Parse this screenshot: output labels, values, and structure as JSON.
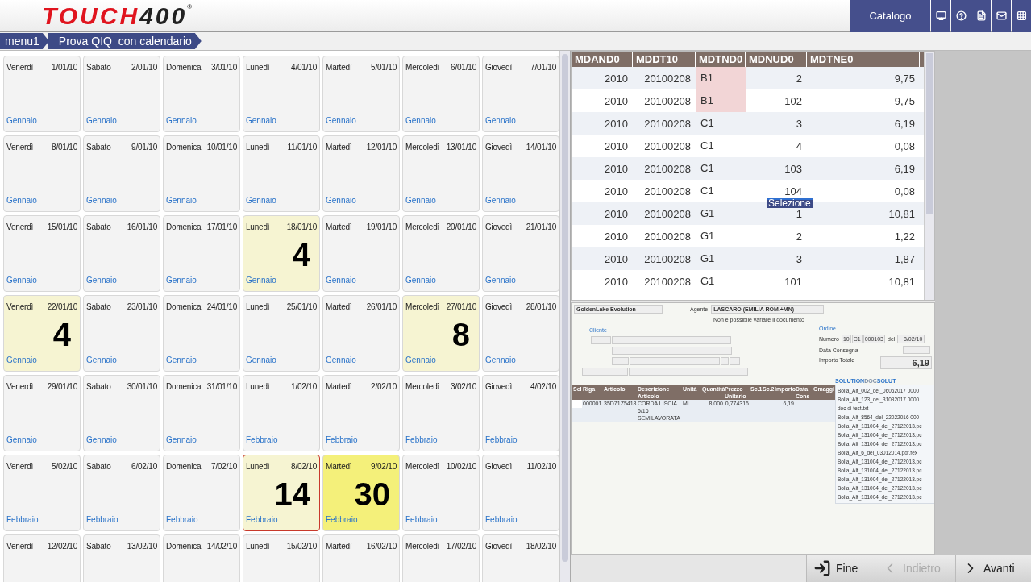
{
  "header": {
    "logo": {
      "red": "TOUCH",
      "dark": "400",
      "mark": "®"
    },
    "catalog_button": "Catalogo"
  },
  "breadcrumb": [
    "menu1",
    "Prova QIQ  con calendario"
  ],
  "calendar": [
    [
      {
        "day": "Venerdì",
        "date": "1/01/10",
        "month": "Gennaio",
        "color": "#f3f3f3",
        "selected": false
      },
      {
        "day": "Sabato",
        "date": "2/01/10",
        "month": "Gennaio",
        "color": "#f3f3f3",
        "selected": false
      },
      {
        "day": "Domenica",
        "date": "3/01/10",
        "month": "Gennaio",
        "color": "#f3f3f3",
        "selected": false
      },
      {
        "day": "Lunedì",
        "date": "4/01/10",
        "month": "Gennaio",
        "color": "#f3f3f3",
        "selected": false
      },
      {
        "day": "Martedì",
        "date": "5/01/10",
        "month": "Gennaio",
        "color": "#f3f3f3",
        "selected": false
      },
      {
        "day": "Mercoledì",
        "date": "6/01/10",
        "month": "Gennaio",
        "color": "#f3f3f3",
        "selected": false
      },
      {
        "day": "Giovedì",
        "date": "7/01/10",
        "month": "Gennaio",
        "color": "#f3f3f3",
        "selected": false
      }
    ],
    [
      {
        "day": "Venerdì",
        "date": "8/01/10",
        "month": "Gennaio",
        "color": "#f3f3f3",
        "selected": false
      },
      {
        "day": "Sabato",
        "date": "9/01/10",
        "month": "Gennaio",
        "color": "#f3f3f3",
        "selected": false
      },
      {
        "day": "Domenica",
        "date": "10/01/10",
        "month": "Gennaio",
        "color": "#f3f3f3",
        "selected": false
      },
      {
        "day": "Lunedì",
        "date": "11/01/10",
        "month": "Gennaio",
        "color": "#f3f3f3",
        "selected": false
      },
      {
        "day": "Martedì",
        "date": "12/01/10",
        "month": "Gennaio",
        "color": "#f3f3f3",
        "selected": false
      },
      {
        "day": "Mercoledì",
        "date": "13/01/10",
        "month": "Gennaio",
        "color": "#f3f3f3",
        "selected": false
      },
      {
        "day": "Giovedì",
        "date": "14/01/10",
        "month": "Gennaio",
        "color": "#f3f3f3",
        "selected": false
      }
    ],
    [
      {
        "day": "Venerdì",
        "date": "15/01/10",
        "month": "Gennaio",
        "color": "#f3f3f3",
        "selected": false
      },
      {
        "day": "Sabato",
        "date": "16/01/10",
        "month": "Gennaio",
        "color": "#f3f3f3",
        "selected": false
      },
      {
        "day": "Domenica",
        "date": "17/01/10",
        "month": "Gennaio",
        "color": "#f3f3f3",
        "selected": false
      },
      {
        "day": "Lunedì",
        "date": "18/01/10",
        "month": "Gennaio",
        "count": "4",
        "color": "#f6f4d2",
        "selected": false
      },
      {
        "day": "Martedì",
        "date": "19/01/10",
        "month": "Gennaio",
        "color": "#f3f3f3",
        "selected": false
      },
      {
        "day": "Mercoledì",
        "date": "20/01/10",
        "month": "Gennaio",
        "color": "#f3f3f3",
        "selected": false
      },
      {
        "day": "Giovedì",
        "date": "21/01/10",
        "month": "Gennaio",
        "color": "#f3f3f3",
        "selected": false
      }
    ],
    [
      {
        "day": "Venerdì",
        "date": "22/01/10",
        "month": "Gennaio",
        "count": "4",
        "color": "#f6f4d2",
        "selected": false
      },
      {
        "day": "Sabato",
        "date": "23/01/10",
        "month": "Gennaio",
        "color": "#f3f3f3",
        "selected": false
      },
      {
        "day": "Domenica",
        "date": "24/01/10",
        "month": "Gennaio",
        "color": "#f3f3f3",
        "selected": false
      },
      {
        "day": "Lunedì",
        "date": "25/01/10",
        "month": "Gennaio",
        "color": "#f3f3f3",
        "selected": false
      },
      {
        "day": "Martedì",
        "date": "26/01/10",
        "month": "Gennaio",
        "color": "#f3f3f3",
        "selected": false
      },
      {
        "day": "Mercoledì",
        "date": "27/01/10",
        "month": "Gennaio",
        "count": "8",
        "color": "#f6f4d2",
        "selected": false
      },
      {
        "day": "Giovedì",
        "date": "28/01/10",
        "month": "Gennaio",
        "color": "#f3f3f3",
        "selected": false
      }
    ],
    [
      {
        "day": "Venerdì",
        "date": "29/01/10",
        "month": "Gennaio",
        "color": "#f3f3f3",
        "selected": false
      },
      {
        "day": "Sabato",
        "date": "30/01/10",
        "month": "Gennaio",
        "color": "#f3f3f3",
        "selected": false
      },
      {
        "day": "Domenica",
        "date": "31/01/10",
        "month": "Gennaio",
        "color": "#f3f3f3",
        "selected": false
      },
      {
        "day": "Lunedì",
        "date": "1/02/10",
        "month": "Febbraio",
        "color": "#f3f3f3",
        "selected": false
      },
      {
        "day": "Martedì",
        "date": "2/02/10",
        "month": "Febbraio",
        "color": "#f3f3f3",
        "selected": false
      },
      {
        "day": "Mercoledì",
        "date": "3/02/10",
        "month": "Febbraio",
        "color": "#f3f3f3",
        "selected": false
      },
      {
        "day": "Giovedì",
        "date": "4/02/10",
        "month": "Febbraio",
        "color": "#f3f3f3",
        "selected": false
      }
    ],
    [
      {
        "day": "Venerdì",
        "date": "5/02/10",
        "month": "Febbraio",
        "color": "#f3f3f3",
        "selected": false
      },
      {
        "day": "Sabato",
        "date": "6/02/10",
        "month": "Febbraio",
        "color": "#f3f3f3",
        "selected": false
      },
      {
        "day": "Domenica",
        "date": "7/02/10",
        "month": "Febbraio",
        "color": "#f3f3f3",
        "selected": false
      },
      {
        "day": "Lunedì",
        "date": "8/02/10",
        "month": "Febbraio",
        "count": "14",
        "color": "#f6f4d2",
        "selected": true
      },
      {
        "day": "Martedì",
        "date": "9/02/10",
        "month": "Febbraio",
        "count": "30",
        "color": "#f4f07a",
        "selected": false
      },
      {
        "day": "Mercoledì",
        "date": "10/02/10",
        "month": "Febbraio",
        "color": "#f3f3f3",
        "selected": false
      },
      {
        "day": "Giovedì",
        "date": "11/02/10",
        "month": "Febbraio",
        "color": "#f3f3f3",
        "selected": false
      }
    ],
    [
      {
        "day": "Venerdì",
        "date": "12/02/10",
        "color": "#f3f3f3",
        "selected": false
      },
      {
        "day": "Sabato",
        "date": "13/02/10",
        "color": "#f3f3f3",
        "selected": false
      },
      {
        "day": "Domenica",
        "date": "14/02/10",
        "color": "#f3f3f3",
        "selected": false
      },
      {
        "day": "Lunedì",
        "date": "15/02/10",
        "color": "#f3f3f3",
        "selected": false
      },
      {
        "day": "Martedì",
        "date": "16/02/10",
        "color": "#f3f3f3",
        "selected": false
      },
      {
        "day": "Mercoledì",
        "date": "17/02/10",
        "color": "#f3f3f3",
        "selected": false
      },
      {
        "day": "Giovedì",
        "date": "18/02/10",
        "color": "#f3f3f3",
        "selected": false
      }
    ]
  ],
  "table": {
    "columns": [
      "MDAND0",
      "MDDT10",
      "MDTND0",
      "MDNUD0",
      "MDTNE0"
    ],
    "rows": [
      {
        "cells": [
          "2010",
          "20100208",
          "B1",
          "2",
          "9,75"
        ],
        "marked": true
      },
      {
        "cells": [
          "2010",
          "20100208",
          "B1",
          "102",
          "9,75"
        ],
        "marked": true
      },
      {
        "cells": [
          "2010",
          "20100208",
          "C1",
          "3",
          "6,19"
        ],
        "marked": false
      },
      {
        "cells": [
          "2010",
          "20100208",
          "C1",
          "4",
          "0,08"
        ],
        "marked": false
      },
      {
        "cells": [
          "2010",
          "20100208",
          "C1",
          "103",
          "6,19"
        ],
        "marked": false
      },
      {
        "cells": [
          "2010",
          "20100208",
          "C1",
          "104",
          "0,08"
        ],
        "marked": false
      },
      {
        "cells": [
          "2010",
          "20100208",
          "G1",
          "1",
          "10,81"
        ],
        "marked": false
      },
      {
        "cells": [
          "2010",
          "20100208",
          "G1",
          "2",
          "1,22"
        ],
        "marked": false
      },
      {
        "cells": [
          "2010",
          "20100208",
          "G1",
          "3",
          "1,87"
        ],
        "marked": false
      },
      {
        "cells": [
          "2010",
          "20100208",
          "G1",
          "101",
          "10,81"
        ],
        "marked": false
      }
    ],
    "tooltip": "Selezione"
  },
  "document": {
    "company": "GoldenLake Evolution",
    "agent_label": "Agente",
    "agent": "LASCARO (EMILIA ROM.+MN)",
    "notice": "Non è possibile variare il documento",
    "client_label": "Cliente",
    "order_label": "Ordine",
    "number_label": "Numero",
    "number": [
      "10",
      "C1",
      "000103"
    ],
    "date_label": "del",
    "date": "8/02/10",
    "delivery_label": "Data Consegna",
    "total_label": "Importo Totale",
    "total": "6,19",
    "columns": [
      "Sel",
      "Riga",
      "Articolo",
      "Descrizione Articolo",
      "Unità",
      "Quantità",
      "Prezzo Unitario",
      "Sc.1",
      "Sc.2",
      "Importo",
      "Data Cons",
      "Omaggi"
    ],
    "line": {
      "checked": false,
      "row": "000001",
      "article": "35D71Z5418",
      "description": "CORDA LISCIA 5/16 SEMILAVORATA",
      "unit": "MI",
      "quantity": "8,000",
      "unit_price": "0,774316",
      "amount": "6,19"
    },
    "attachments_title": {
      "a": "SOLUTION",
      "b": "DOC",
      "c": "SOLUT"
    },
    "attachments": [
      "Bolla_Alt_002_del_06062017 0000",
      "Bolla_Alt_123_del_31032017 0000",
      "doc di test.txt",
      "Bolla_Alt_8564_del_22022016 000",
      "Bolla_Alt_131004_del_27122013.pc",
      "Bolla_Alt_131004_del_27122013.pc",
      "Bolla_Alt_131004_del_27122013.pc",
      "Bolla_Alt_6_del_03012014.pdf.fex",
      "Bolla_Alt_131004_del_27122013.pc",
      "Bolla_Alt_131004_del_27122013.pc",
      "Bolla_Alt_131004_del_27122013.pc",
      "Bolla_Alt_131004_del_27122013.pc",
      "Bolla_Alt_131004_del_27122013.pc"
    ]
  },
  "footer": [
    {
      "label": "Fine",
      "kind": "exit",
      "disabled": false
    },
    {
      "label": "Indietro",
      "kind": "back",
      "disabled": true
    },
    {
      "label": "Avanti",
      "kind": "next",
      "disabled": false
    }
  ]
}
